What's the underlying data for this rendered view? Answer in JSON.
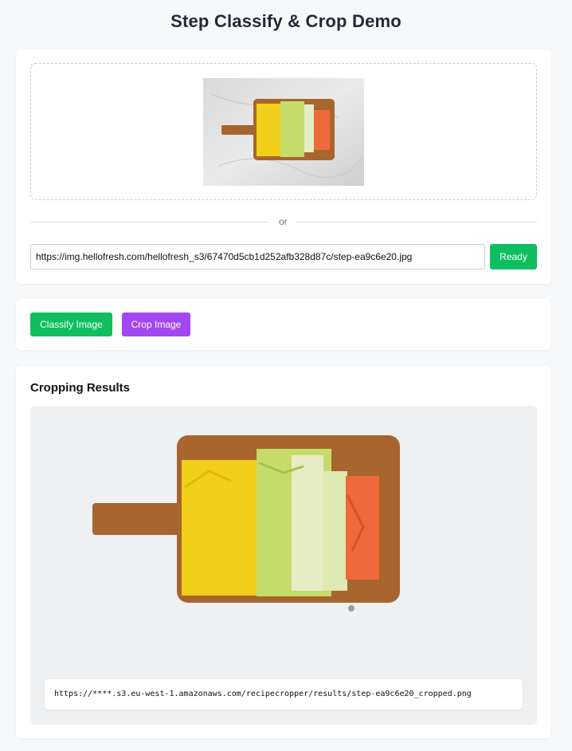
{
  "header": {
    "title": "Step Classify & Crop Demo"
  },
  "upload": {
    "preview_icon": "cutting-board-vegetables-image",
    "divider_text": "or",
    "url_value": "https://img.hellofresh.com/hellofresh_s3/67470d5cb1d252afb328d87c/step-ea9c6e20.jpg",
    "ready_label": "Ready"
  },
  "actions": {
    "classify_label": "Classify Image",
    "crop_label": "Crop Image"
  },
  "results": {
    "heading": "Cropping Results",
    "cropped_icon": "cropped-cutting-board-image",
    "url": "https://****.s3.eu-west-1.amazonaws.com/recipecropper/results/step-ea9c6e20_cropped.png"
  },
  "colors": {
    "green": "#0fbf5f",
    "purple": "#a347f0",
    "board": "#a8652e",
    "yellow": "#f2cf1a",
    "leek": "#c6dc6a",
    "carrot": "#ee6a3a"
  }
}
